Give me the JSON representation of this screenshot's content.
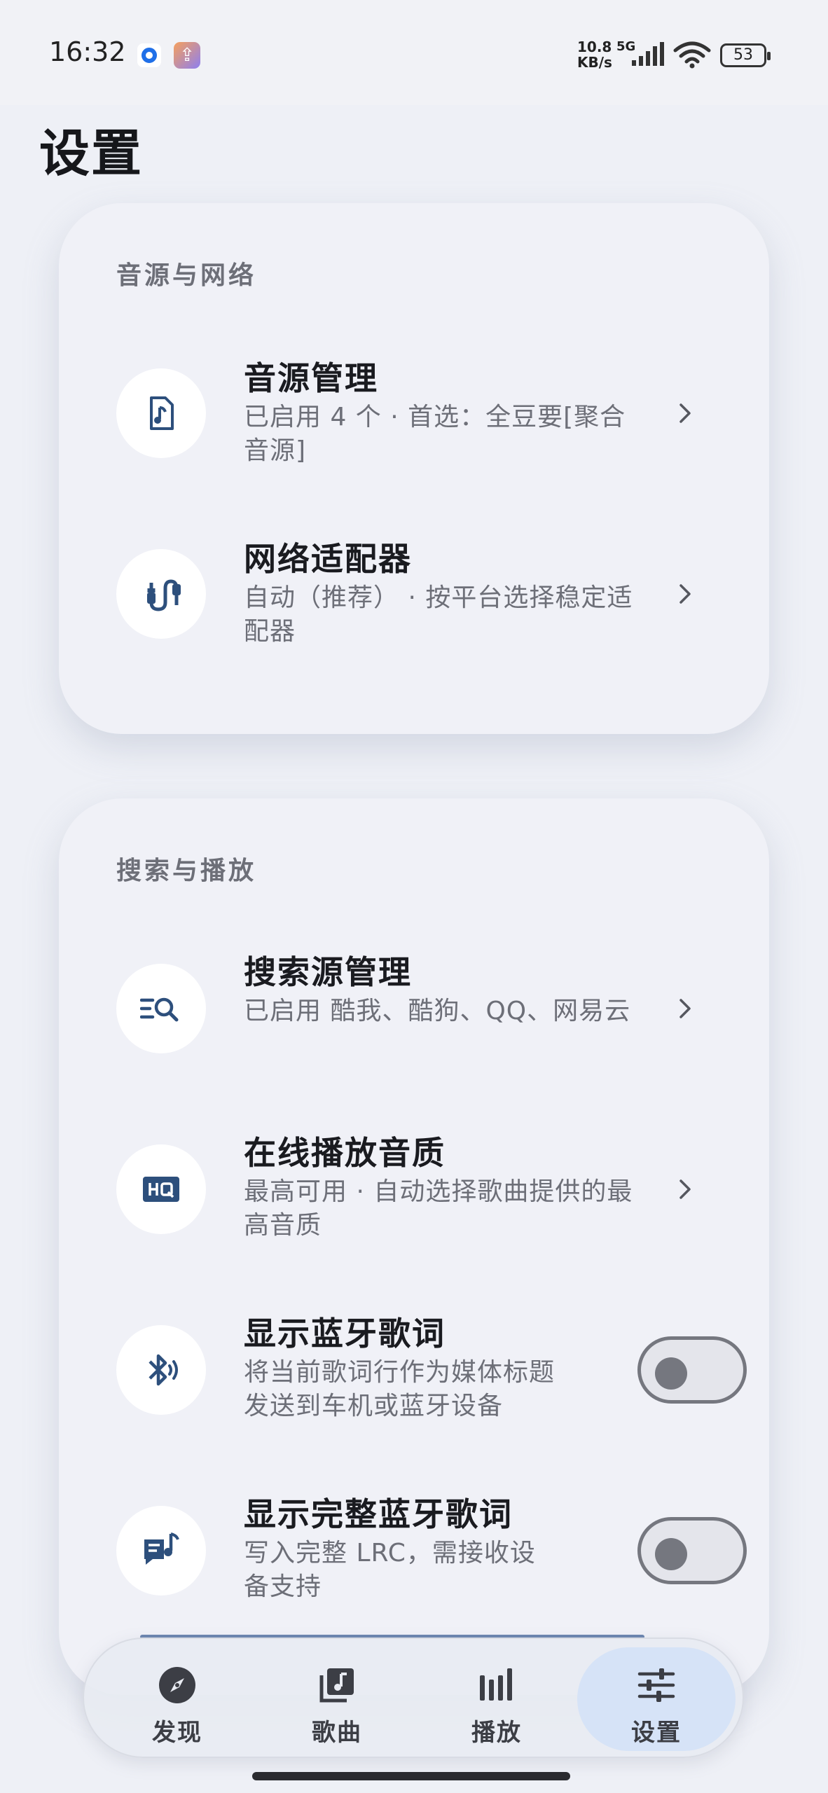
{
  "status_bar": {
    "time": "16:32",
    "net_speed_value": "10.8",
    "net_speed_unit": "KB/s",
    "network_type": "5G",
    "battery": "53"
  },
  "page": {
    "title": "设置"
  },
  "sections": [
    {
      "title": "音源与网络",
      "items": [
        {
          "title": "音源管理",
          "desc": "已启用 4 个 · 首选：全豆要[聚合音源]",
          "icon": "music-file-icon",
          "control": "chevron"
        },
        {
          "title": "网络适配器",
          "desc": "自动（推荐） · 按平台选择稳定适配器",
          "icon": "cable-icon",
          "control": "chevron"
        }
      ]
    },
    {
      "title": "搜索与播放",
      "items": [
        {
          "title": "搜索源管理",
          "desc": "已启用 酷我、酷狗、QQ、网易云",
          "icon": "search-list-icon",
          "control": "chevron"
        },
        {
          "title": "在线播放音质",
          "desc": "最高可用 · 自动选择歌曲提供的最高音质",
          "icon": "hq-icon",
          "control": "chevron"
        },
        {
          "title": "显示蓝牙歌词",
          "desc": "将当前歌词行作为媒体标题发送到车机或蓝牙设备",
          "icon": "bluetooth-audio-icon",
          "control": "toggle",
          "enabled": false
        },
        {
          "title": "显示完整蓝牙歌词",
          "desc": "写入完整 LRC，需接收设备支持",
          "icon": "lyrics-icon",
          "control": "toggle",
          "enabled": false
        }
      ]
    }
  ],
  "bottom_nav": {
    "items": [
      {
        "label": "发现",
        "icon": "compass-icon"
      },
      {
        "label": "歌曲",
        "icon": "music-library-icon"
      },
      {
        "label": "播放",
        "icon": "equalizer-bars-icon"
      },
      {
        "label": "设置",
        "icon": "sliders-icon"
      }
    ],
    "active": "设置"
  },
  "colors": {
    "background": "#eef0f6",
    "card": "#f0f1f7",
    "icon_blue": "#2d4f7c",
    "active_nav": "#d6e3f7",
    "accent_line": "#6c86b0"
  }
}
